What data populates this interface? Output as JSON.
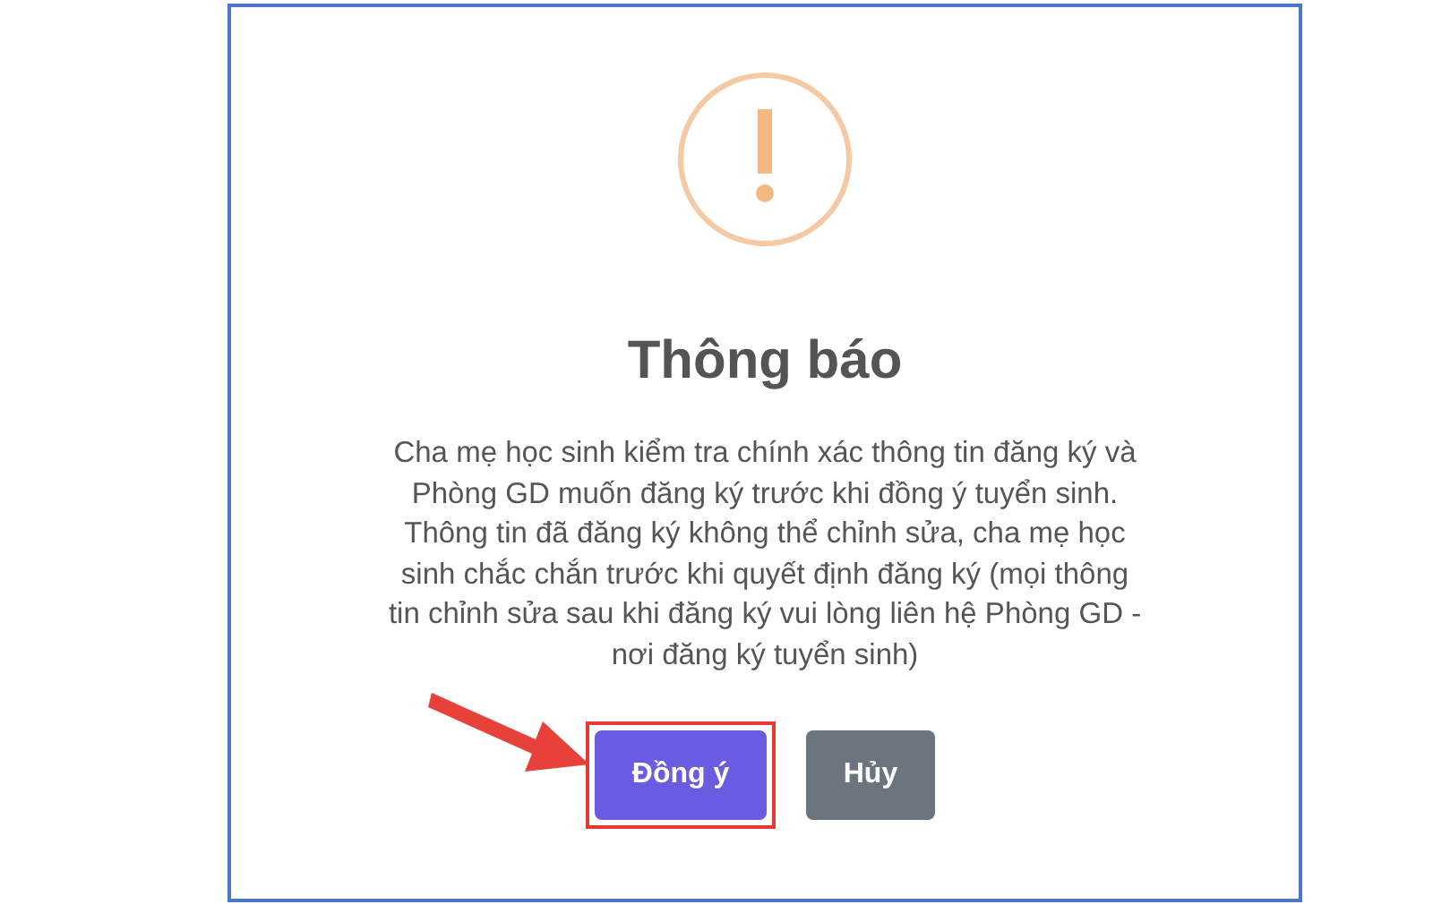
{
  "dialog": {
    "title": "Thông báo",
    "message_lines": [
      "Cha mẹ học sinh kiểm tra chính xác thông tin đăng ký và",
      "Phòng GD muốn đăng ký trước khi đồng ý tuyển sinh.",
      "Thông tin đã đăng ký không thể chỉnh sửa, cha mẹ học",
      "sinh chắc chắn trước khi quyết định đăng ký (mọi thông",
      "tin chỉnh sửa sau khi đăng ký vui lòng liên hệ Phòng GD -",
      "nơi đăng ký tuyển sinh)"
    ],
    "buttons": [
      {
        "label": "Đồng ý",
        "kind": "primary",
        "highlighted": true
      },
      {
        "label": "Hủy",
        "kind": "secondary",
        "highlighted": false
      }
    ]
  }
}
